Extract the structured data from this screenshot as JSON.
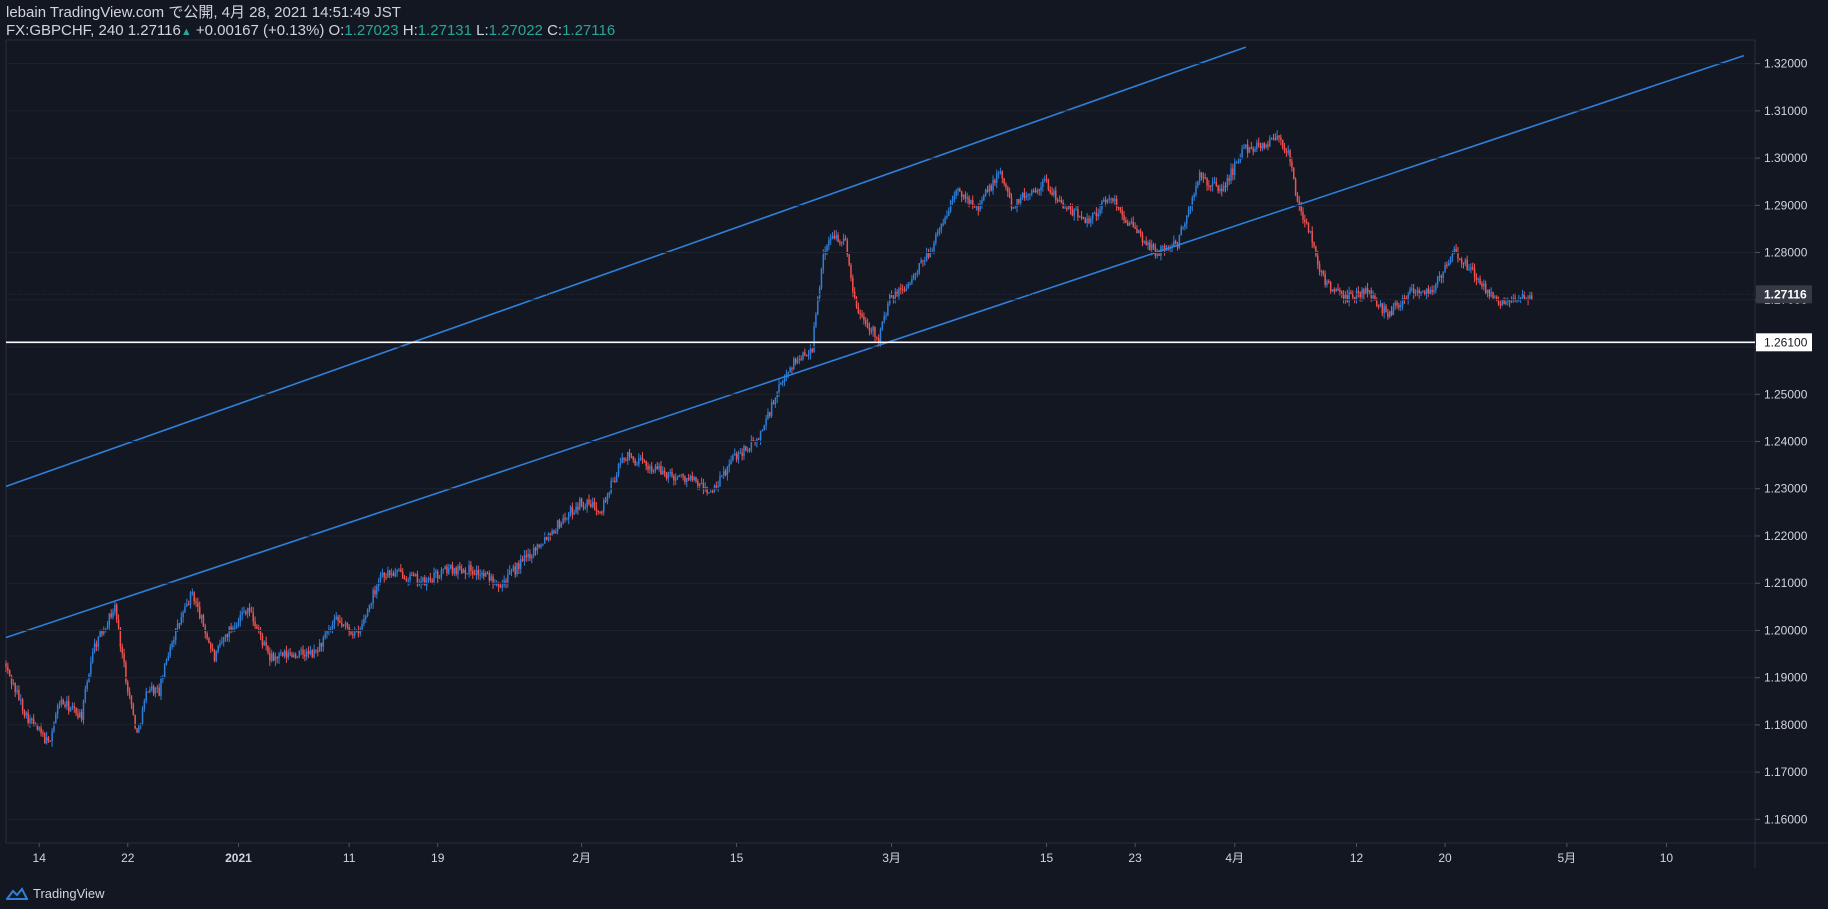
{
  "header": {
    "published_line": "lebain TradingView.com で公開, 4月 28, 2021 14:51:49 JST",
    "symbol": "FX:GBPCHF, 240",
    "last": "1.27116",
    "change": "+0.00167 (+0.13%)",
    "open_label": "O:",
    "open_value": "1.27023",
    "high_label": "H:",
    "high_value": "1.27131",
    "low_label": "L:",
    "low_value": "1.27022",
    "close_label": "C:",
    "close_value": "1.27116"
  },
  "footer": {
    "brand": "TradingView"
  },
  "colors": {
    "background": "#131722",
    "up": "#2f7fd9",
    "down": "#ef5350",
    "trendline": "#2f7fd9",
    "hline": "#ffffff",
    "axis_text": "#d1d4dc",
    "positive": "#26a69a"
  },
  "chart_data": {
    "type": "candlestick",
    "symbol": "FX:GBPCHF",
    "interval": "240",
    "ylim": [
      1.155,
      1.325
    ],
    "y_ticks": [
      "1.32000",
      "1.31000",
      "1.30000",
      "1.29000",
      "1.28000",
      "1.27000",
      "1.26000",
      "1.25000",
      "1.24000",
      "1.23000",
      "1.22000",
      "1.21000",
      "1.20000",
      "1.19000",
      "1.18000",
      "1.17000",
      "1.16000"
    ],
    "x_tick_labels": [
      "14",
      "22",
      "2021",
      "11",
      "19",
      "2月",
      "15",
      "3月",
      "15",
      "23",
      "4月",
      "12",
      "20",
      "5月",
      "10"
    ],
    "x_tick_dates": [
      "2020-12-14",
      "2020-12-22",
      "2021-01-01",
      "2021-01-11",
      "2021-01-19",
      "2021-02-01",
      "2021-02-15",
      "2021-03-01",
      "2021-03-15",
      "2021-03-23",
      "2021-04-01",
      "2021-04-12",
      "2021-04-20",
      "2021-05-01",
      "2021-05-10"
    ],
    "x_range": [
      "2020-12-11",
      "2021-05-18"
    ],
    "last_price_label": "1.27116",
    "last_price": 1.27116,
    "horizontal_line": {
      "price": 1.261,
      "label": "1.26100"
    },
    "trendlines": [
      {
        "from": [
          "2020-12-11",
          1.2305
        ],
        "to": [
          "2021-04-02",
          1.3235
        ]
      },
      {
        "from": [
          "2020-12-11",
          1.1985
        ],
        "to": [
          "2021-05-17",
          1.3217
        ]
      }
    ],
    "price_path": [
      [
        "2020-12-11",
        1.193
      ],
      [
        "2020-12-13",
        1.182
      ],
      [
        "2020-12-15",
        1.176
      ],
      [
        "2020-12-16",
        1.185
      ],
      [
        "2020-12-18",
        1.182
      ],
      [
        "2020-12-19",
        1.196
      ],
      [
        "2020-12-21",
        1.205
      ],
      [
        "2020-12-22",
        1.19
      ],
      [
        "2020-12-23",
        1.178
      ],
      [
        "2020-12-24",
        1.188
      ],
      [
        "2020-12-25",
        1.187
      ],
      [
        "2020-12-26",
        1.197
      ],
      [
        "2020-12-28",
        1.208
      ],
      [
        "2020-12-30",
        1.194
      ],
      [
        "2020-12-31",
        1.199
      ],
      [
        "2021-01-02",
        1.205
      ],
      [
        "2021-01-04",
        1.194
      ],
      [
        "2021-01-06",
        1.195
      ],
      [
        "2021-01-08",
        1.195
      ],
      [
        "2021-01-10",
        1.202
      ],
      [
        "2021-01-12",
        1.199
      ],
      [
        "2021-01-14",
        1.212
      ],
      [
        "2021-01-16",
        1.212
      ],
      [
        "2021-01-18",
        1.21
      ],
      [
        "2021-01-20",
        1.213
      ],
      [
        "2021-01-22",
        1.213
      ],
      [
        "2021-01-23",
        1.212
      ],
      [
        "2021-01-25",
        1.21
      ],
      [
        "2021-01-27",
        1.215
      ],
      [
        "2021-01-29",
        1.22
      ],
      [
        "2021-02-01",
        1.227
      ],
      [
        "2021-02-03",
        1.226
      ],
      [
        "2021-02-05",
        1.237
      ],
      [
        "2021-02-07",
        1.235
      ],
      [
        "2021-02-09",
        1.233
      ],
      [
        "2021-02-11",
        1.232
      ],
      [
        "2021-02-13",
        1.229
      ],
      [
        "2021-02-15",
        1.237
      ],
      [
        "2021-02-17",
        1.24
      ],
      [
        "2021-02-19",
        1.251
      ],
      [
        "2021-02-20",
        1.256
      ],
      [
        "2021-02-22",
        1.26
      ],
      [
        "2021-02-23",
        1.28
      ],
      [
        "2021-02-24",
        1.284
      ],
      [
        "2021-02-25",
        1.282
      ],
      [
        "2021-02-26",
        1.268
      ],
      [
        "2021-02-28",
        1.262
      ],
      [
        "2021-03-01",
        1.27
      ],
      [
        "2021-03-03",
        1.274
      ],
      [
        "2021-03-05",
        1.282
      ],
      [
        "2021-03-07",
        1.293
      ],
      [
        "2021-03-09",
        1.29
      ],
      [
        "2021-03-11",
        1.297
      ],
      [
        "2021-03-12",
        1.29
      ],
      [
        "2021-03-15",
        1.295
      ],
      [
        "2021-03-17",
        1.289
      ],
      [
        "2021-03-19",
        1.287
      ],
      [
        "2021-03-21",
        1.292
      ],
      [
        "2021-03-23",
        1.285
      ],
      [
        "2021-03-25",
        1.28
      ],
      [
        "2021-03-27",
        1.282
      ],
      [
        "2021-03-29",
        1.296
      ],
      [
        "2021-03-31",
        1.293
      ],
      [
        "2021-04-02",
        1.302
      ],
      [
        "2021-04-04",
        1.303
      ],
      [
        "2021-04-05",
        1.305
      ],
      [
        "2021-04-06",
        1.301
      ],
      [
        "2021-04-07",
        1.289
      ],
      [
        "2021-04-08",
        1.284
      ],
      [
        "2021-04-09",
        1.275
      ],
      [
        "2021-04-11",
        1.27
      ],
      [
        "2021-04-13",
        1.272
      ],
      [
        "2021-04-15",
        1.267
      ],
      [
        "2021-04-17",
        1.272
      ],
      [
        "2021-04-19",
        1.272
      ],
      [
        "2021-04-21",
        1.28
      ],
      [
        "2021-04-23",
        1.275
      ],
      [
        "2021-04-24",
        1.271
      ],
      [
        "2021-04-26",
        1.269
      ],
      [
        "2021-04-28",
        1.271
      ]
    ]
  }
}
